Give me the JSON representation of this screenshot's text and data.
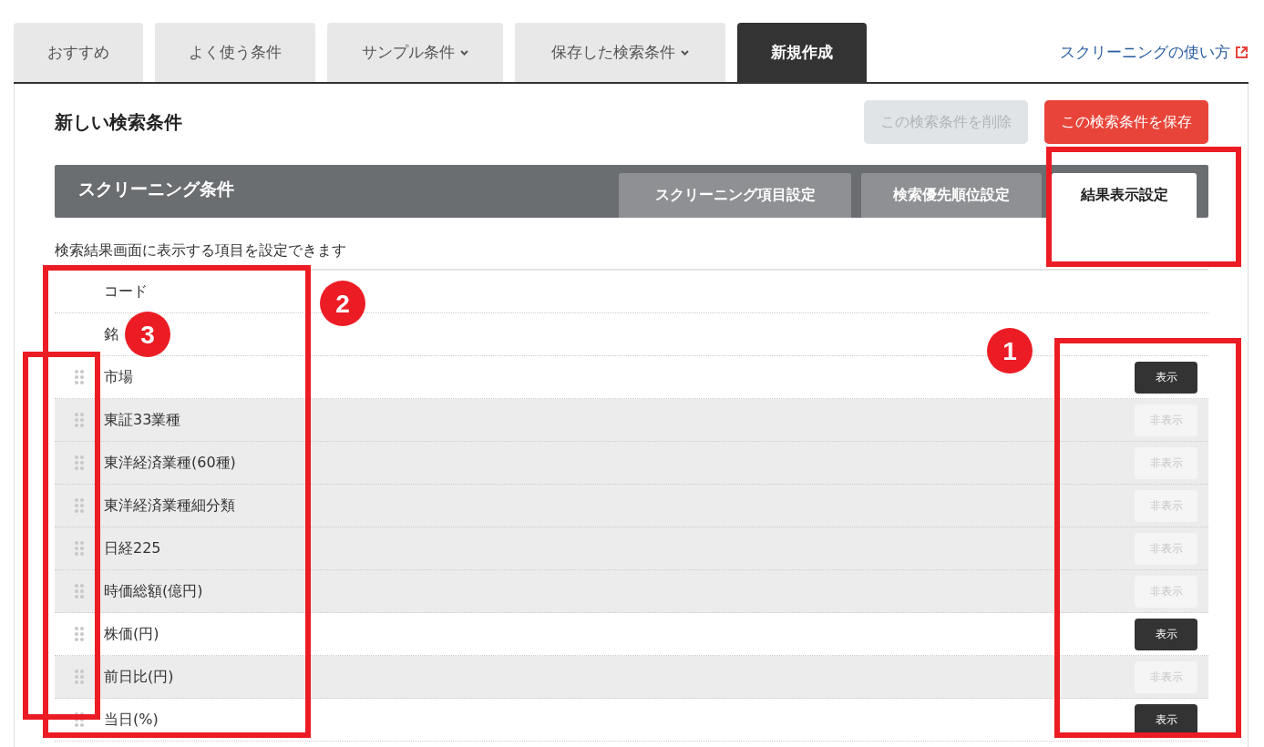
{
  "nav_tabs": [
    {
      "label": "おすすめ",
      "selected": false,
      "has_menu": false
    },
    {
      "label": "よく使う条件",
      "selected": false,
      "has_menu": false
    },
    {
      "label": "サンプル条件",
      "selected": false,
      "has_menu": true
    },
    {
      "label": "保存した検索条件",
      "selected": false,
      "has_menu": true
    },
    {
      "label": "新規作成",
      "selected": true,
      "has_menu": false
    }
  ],
  "help_link": "スクリーニングの使い方",
  "title": "新しい検索条件",
  "buttons": [
    {
      "label": "この検索条件を削除",
      "disabled": true
    },
    {
      "label": "この検索条件を保存",
      "disabled": false
    }
  ],
  "section": {
    "title": "スクリーニング条件",
    "tabs": [
      {
        "label": "スクリーニング項目設定",
        "selected": false
      },
      {
        "label": "検索優先順位設定",
        "selected": false
      },
      {
        "label": "結果表示設定",
        "selected": true
      }
    ]
  },
  "description": "検索結果画面に表示する項目を設定できます",
  "rows": [
    {
      "kind": "fixed",
      "label": "コード"
    },
    {
      "kind": "fixed",
      "label": "銘"
    },
    {
      "kind": "toggle",
      "label": "市場",
      "shown": true,
      "button": "表示"
    },
    {
      "kind": "toggle",
      "label": "東証33業種",
      "shown": false,
      "button": "非表示"
    },
    {
      "kind": "toggle",
      "label": "東洋経済業種(60種)",
      "shown": false,
      "button": "非表示"
    },
    {
      "kind": "toggle",
      "label": "東洋経済業種細分類",
      "shown": false,
      "button": "非表示"
    },
    {
      "kind": "toggle",
      "label": "日経225",
      "shown": false,
      "button": "非表示"
    },
    {
      "kind": "toggle",
      "label": "時価総額(億円)",
      "shown": false,
      "button": "非表示"
    },
    {
      "kind": "toggle",
      "label": "株価(円)",
      "shown": true,
      "button": "表示"
    },
    {
      "kind": "toggle",
      "label": "前日比(円)",
      "shown": false,
      "button": "非表示"
    },
    {
      "kind": "toggle",
      "label": "当日(%)",
      "shown": true,
      "button": "表示"
    }
  ],
  "annotation_markers": [
    "1",
    "2",
    "3"
  ]
}
